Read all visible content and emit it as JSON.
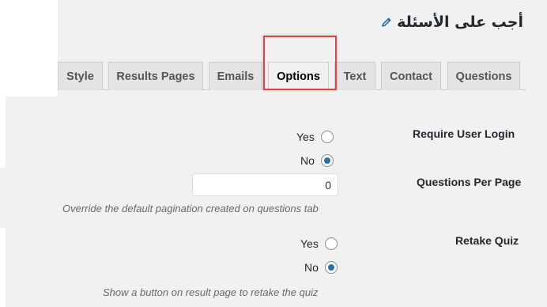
{
  "header": {
    "title": "أجب على الأسئلة",
    "edit_icon": "pencil-icon"
  },
  "tabs": [
    {
      "label": "Style",
      "active": false
    },
    {
      "label": "Results Pages",
      "active": false
    },
    {
      "label": "Emails",
      "active": false
    },
    {
      "label": "Options",
      "active": true
    },
    {
      "label": "Text",
      "active": false
    },
    {
      "label": "Contact",
      "active": false
    },
    {
      "label": "Questions",
      "active": false
    }
  ],
  "options": {
    "require_login": {
      "label": "Require User Login",
      "choices": [
        {
          "label": "Yes",
          "checked": false
        },
        {
          "label": "No",
          "checked": true
        }
      ]
    },
    "questions_per_page": {
      "label": "Questions Per Page",
      "value": "0",
      "description": "Override the default pagination created on questions tab"
    },
    "retake_quiz": {
      "label": "Retake Quiz",
      "choices": [
        {
          "label": "Yes",
          "checked": false
        },
        {
          "label": "No",
          "checked": true
        }
      ],
      "description": "Show a button on result page to retake the quiz"
    }
  },
  "colors": {
    "highlight_border": "#e04343",
    "radio_checked": "#2271b1",
    "panel_bg": "#f1f1f1"
  }
}
